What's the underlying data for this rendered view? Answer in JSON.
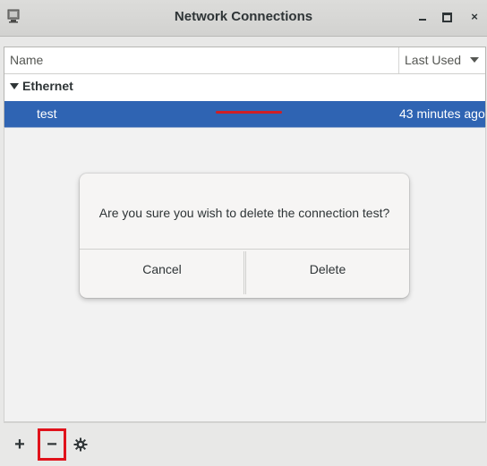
{
  "window": {
    "title": "Network Connections",
    "icon": "network-app-icon",
    "controls": {
      "minimize": "minimize",
      "maximize": "maximize",
      "close": "×"
    }
  },
  "list": {
    "columns": {
      "name": "Name",
      "last_used": "Last Used"
    },
    "groups": [
      {
        "label": "Ethernet",
        "connections": [
          {
            "name": "test",
            "last_used": "43 minutes ago",
            "selected": true
          }
        ]
      }
    ]
  },
  "dialog": {
    "message": "Are you sure you wish to delete the connection test?",
    "cancel_label": "Cancel",
    "delete_label": "Delete"
  },
  "toolbar": {
    "add_label": "+",
    "remove_label": "−",
    "settings_icon": "gear-icon"
  },
  "colors": {
    "selection": "#2f64b3",
    "highlight": "#e0121b"
  }
}
